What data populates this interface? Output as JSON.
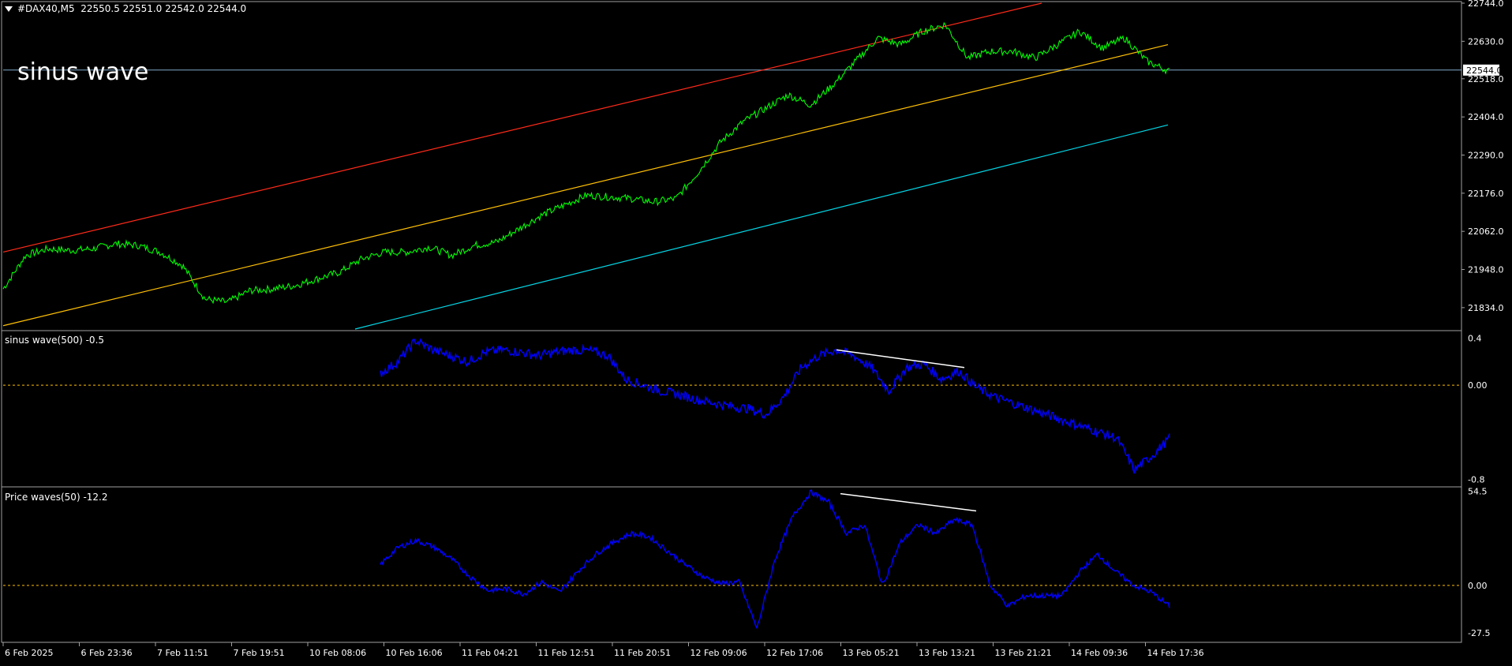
{
  "header": {
    "symbol": "#DAX40,M5",
    "ohlc": "22550.5 22551.0 22542.0 22544.0"
  },
  "annotation": "sinus wave",
  "main": {
    "price_ticks": [
      "22744.0",
      "22630.0",
      "22518.0",
      "22404.0",
      "22290.0",
      "22176.0",
      "22062.0",
      "21948.0",
      "21834.0"
    ],
    "current_price": "22544.0",
    "colors": {
      "price": "#00ff00",
      "upper": "#ff2a1a",
      "mid": "#ffc000",
      "lower": "#00d8e8",
      "grid": "#a0a0a0",
      "hline": "#7fa8c8"
    }
  },
  "ind1": {
    "label": "sinus wave(500) -0.5",
    "ticks": [
      "0.4",
      "0.00",
      "-0.8"
    ],
    "line_color": "#0000ff"
  },
  "ind2": {
    "label": "Price waves(50) -12.2",
    "ticks": [
      "54.5",
      "0.00",
      "-27.5"
    ],
    "line_color": "#0000ff"
  },
  "time_ticks": [
    "6 Feb 2025",
    "6 Feb 23:36",
    "7 Feb 11:51",
    "7 Feb 19:51",
    "10 Feb 08:06",
    "10 Feb 16:06",
    "11 Feb 04:21",
    "11 Feb 12:51",
    "11 Feb 20:51",
    "12 Feb 09:06",
    "12 Feb 17:06",
    "13 Feb 05:21",
    "13 Feb 13:21",
    "13 Feb 21:21",
    "14 Feb 09:36",
    "14 Feb 17:36"
  ],
  "chart_data": [
    {
      "type": "line",
      "title": "#DAX40,M5",
      "y_ticks": [
        21834.0,
        21948.0,
        22062.0,
        22176.0,
        22290.0,
        22404.0,
        22518.0,
        22630.0,
        22744.0
      ],
      "ylim": [
        21770,
        22744
      ],
      "current_value": 22544.0,
      "x_labels": [
        "6 Feb 2025",
        "6 Feb 23:36",
        "7 Feb 11:51",
        "7 Feb 19:51",
        "10 Feb 08:06",
        "10 Feb 16:06",
        "11 Feb 04:21",
        "11 Feb 12:51",
        "11 Feb 20:51",
        "12 Feb 09:06",
        "12 Feb 17:06",
        "13 Feb 05:21",
        "13 Feb 13:21",
        "13 Feb 21:21",
        "14 Feb 09:36",
        "14 Feb 17:36"
      ],
      "series": [
        {
          "name": "#DAX40,M5",
          "values": [
            21890,
            21990,
            22010,
            22005,
            22010,
            22025,
            22020,
            22000,
            21960,
            21860,
            21850,
            21885,
            21890,
            21900,
            21920,
            21940,
            21980,
            22000,
            22000,
            22015,
            21990,
            22020,
            22030,
            22070,
            22110,
            22140,
            22170,
            22165,
            22160,
            22150,
            22160,
            22240,
            22330,
            22390,
            22430,
            22470,
            22440,
            22500,
            22570,
            22640,
            22620,
            22660,
            22680,
            22580,
            22600,
            22600,
            22580,
            22620,
            22660,
            22610,
            22640,
            22570,
            22540
          ]
        }
      ]
    },
    {
      "type": "line",
      "title": "sinus wave(500) -0.5",
      "y_ticks": [
        -0.8,
        0.0,
        0.4
      ],
      "ylim": [
        -0.85,
        0.45
      ],
      "current_value": -0.5,
      "series": [
        {
          "name": "sinus wave(500)",
          "values": [
            0.1,
            0.2,
            0.38,
            0.3,
            0.25,
            0.2,
            0.28,
            0.3,
            0.28,
            0.25,
            0.28,
            0.3,
            0.29,
            0.25,
            0.05,
            0.0,
            -0.05,
            -0.08,
            -0.12,
            -0.15,
            -0.18,
            -0.2,
            -0.25,
            -0.1,
            0.15,
            0.25,
            0.3,
            0.25,
            0.15,
            -0.05,
            0.15,
            0.18,
            0.05,
            0.12,
            -0.02,
            -0.1,
            -0.15,
            -0.2,
            -0.25,
            -0.3,
            -0.35,
            -0.4,
            -0.45,
            -0.72,
            -0.6,
            -0.45
          ]
        }
      ]
    },
    {
      "type": "line",
      "title": "Price waves(50) -12.2",
      "y_ticks": [
        -27.5,
        0.0,
        54.5
      ],
      "ylim": [
        -32,
        56
      ],
      "current_value": -12.2,
      "series": [
        {
          "name": "Price waves(50)",
          "values": [
            12,
            22,
            26,
            22,
            15,
            5,
            -3,
            -2,
            -5,
            2,
            -4,
            8,
            18,
            25,
            30,
            28,
            20,
            12,
            5,
            1,
            2,
            -25,
            15,
            40,
            54,
            48,
            30,
            35,
            0,
            25,
            35,
            30,
            38,
            35,
            0,
            -12,
            -6,
            -6,
            -6,
            8,
            18,
            8,
            0,
            -4,
            -12
          ]
        }
      ]
    }
  ]
}
